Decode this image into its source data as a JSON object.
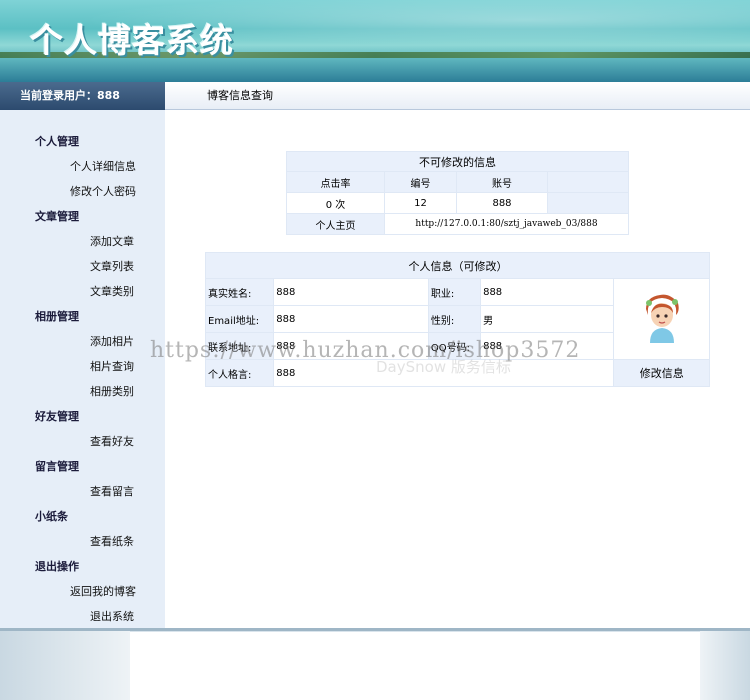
{
  "header": {
    "title": "个人博客系统"
  },
  "userbar": {
    "label": "当前登录用户：888"
  },
  "breadcrumb": {
    "label": "博客信息查询"
  },
  "sidebar": {
    "groups": [
      {
        "label": "个人管理",
        "items": [
          "个人详细信息",
          "修改个人密码"
        ]
      },
      {
        "label": "文章管理",
        "items": [
          "添加文章",
          "文章列表",
          "文章类别"
        ]
      },
      {
        "label": "相册管理",
        "items": [
          "添加相片",
          "相片查询",
          "相册类别"
        ]
      },
      {
        "label": "好友管理",
        "items": [
          "查看好友"
        ]
      },
      {
        "label": "留言管理",
        "items": [
          "查看留言"
        ]
      },
      {
        "label": "小纸条",
        "items": [
          "查看纸条"
        ]
      },
      {
        "label": "退出操作",
        "items": [
          "返回我的博客",
          "退出系统"
        ]
      }
    ]
  },
  "fixed_info": {
    "caption": "不可修改的信息",
    "headers": [
      "点击率",
      "编号",
      "账号"
    ],
    "values": [
      "0  次",
      "12",
      "888"
    ],
    "homepage_label": "个人主页",
    "homepage_url": "http://127.0.0.1:80/sztj_javaweb_03/888"
  },
  "personal_info": {
    "caption": "个人信息（可修改）",
    "rows": [
      {
        "label1": "真实姓名:",
        "value1": "888",
        "label2": "职业:",
        "value2": "888"
      },
      {
        "label1": "Email地址:",
        "value1": "888",
        "label2": "性别:",
        "value2": "男"
      },
      {
        "label1": "联系地址:",
        "value1": "888",
        "label2": "QQ号码:",
        "value2": "888"
      },
      {
        "label1": "个人格言:",
        "value1": "888"
      }
    ],
    "edit_button": "修改信息",
    "avatar_icon": "girl-avatar-icon"
  },
  "watermark": {
    "text": "https://www.huzhan.com/ishop3572",
    "sub": "DaySnow 版务信标"
  }
}
